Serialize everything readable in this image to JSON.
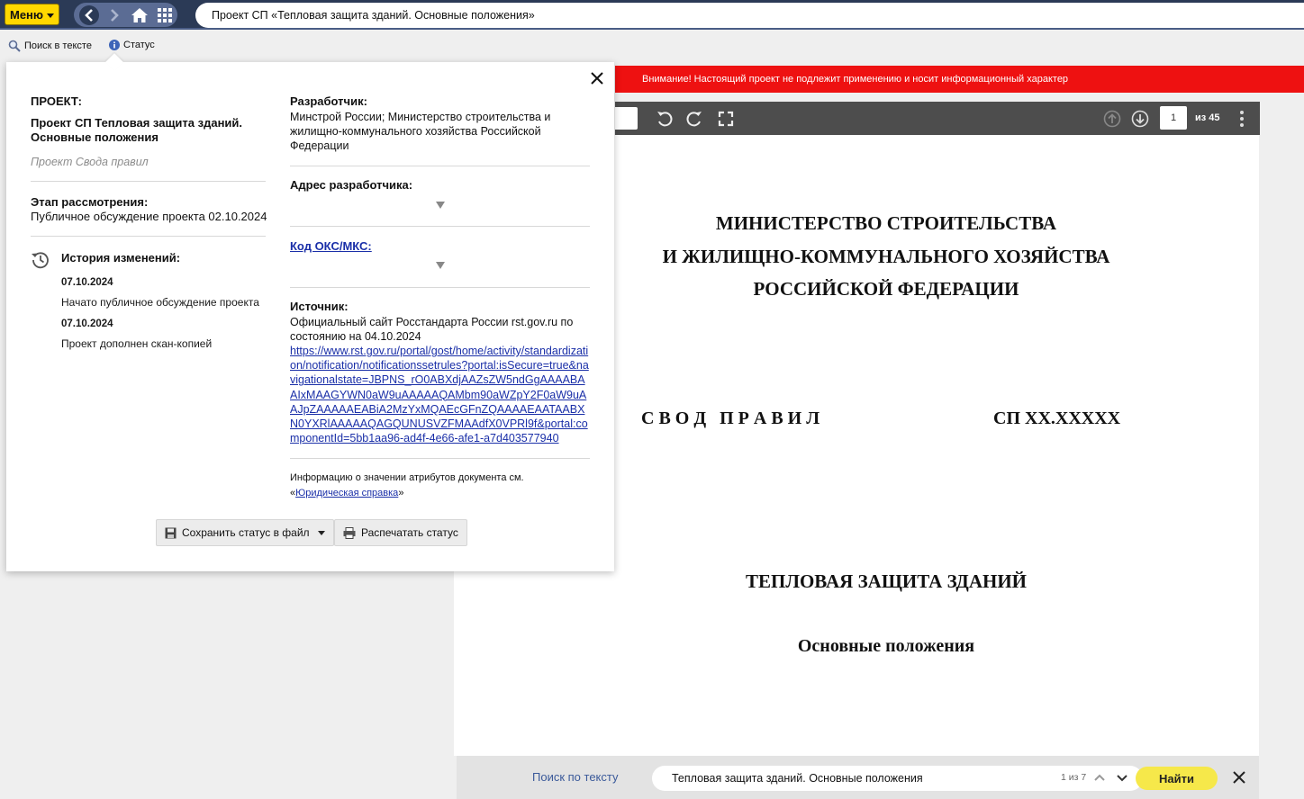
{
  "header": {
    "menu_label": "Меню",
    "document_title": "Проект СП «Тепловая защита зданий. Основные положения»"
  },
  "toolbar": {
    "search_label": "Поиск в тексте",
    "status_label": "Статус"
  },
  "notice": "Внимание! Настоящий проект не подлежит применению и носит информационный характер",
  "viewer": {
    "page_number": "1",
    "page_total": "из 45"
  },
  "document": {
    "ministry_line1": "МИНИСТЕРСТВО СТРОИТЕЛЬСТВА",
    "ministry_line2": "И ЖИЛИЩНО-КОММУНАЛЬНОГО ХОЗЯЙСТВА",
    "ministry_line3": "РОССИЙСКОЙ ФЕДЕРАЦИИ",
    "code_set": "С В О Д   П Р А В И Л",
    "code_number": "СП XX.XXXXX",
    "title": "ТЕПЛОВАЯ ЗАЩИТА ЗДАНИЙ",
    "subtitle": "Основные положения"
  },
  "status_popup": {
    "project_label": "ПРОЕКТ:",
    "project_name": "Проект СП Тепловая защита зданий. Основные положения",
    "project_type": "Проект Свода правил",
    "stage_label": "Этап рассмотрения:",
    "stage_value": "Публичное обсуждение проекта 02.10.2024",
    "history_label": "История изменений:",
    "history": [
      {
        "date": "07.10.2024",
        "text": "Начато публичное обсуждение проекта"
      },
      {
        "date": "07.10.2024",
        "text": "Проект дополнен скан-копией"
      }
    ],
    "developer_label": "Разработчик:",
    "developer_value": "Минстрой России; Министерство строительства и жилищно-коммунального хозяйства Российской Федерации",
    "address_label": "Адрес разработчика:",
    "oks_label": "Код ОКС/МКС:",
    "source_label": "Источник:",
    "source_text": "Официальный сайт Росстандарта России rst.gov.ru по состоянию на 04.10.2024",
    "source_url": "https://www.rst.gov.ru/portal/gost/home/activity/standardization/notification/notificationssetrules?portal:isSecure=true&navigationalstate=JBPNS_rO0ABXdjAAZsZW5ndGgAAAABAAIxMAAGYWN0aW9uAAAAAQAMbm90aWZpY2F0aW9uAAJpZAAAAAEABiA2MzYxMQAEcGFnZQAAAAEAATAABXN0YXRlAAAAAQAGQUNUSVZFMAAdfX0VPRl9f&portal:componentId=5bb1aa96-ad4f-4e66-afe1-a7d403577940",
    "info_text": "Информацию о значении атрибутов документа см.",
    "info_link_open": "«",
    "info_link": "Юридическая справка",
    "info_link_close": "»",
    "save_button": "Сохранить статус в файл",
    "print_button": "Распечатать статус"
  },
  "bottom_search": {
    "label": "Поиск по тексту",
    "query": "Тепловая защита зданий. Основные положения",
    "count": "1 из 7",
    "find_button": "Найти"
  }
}
